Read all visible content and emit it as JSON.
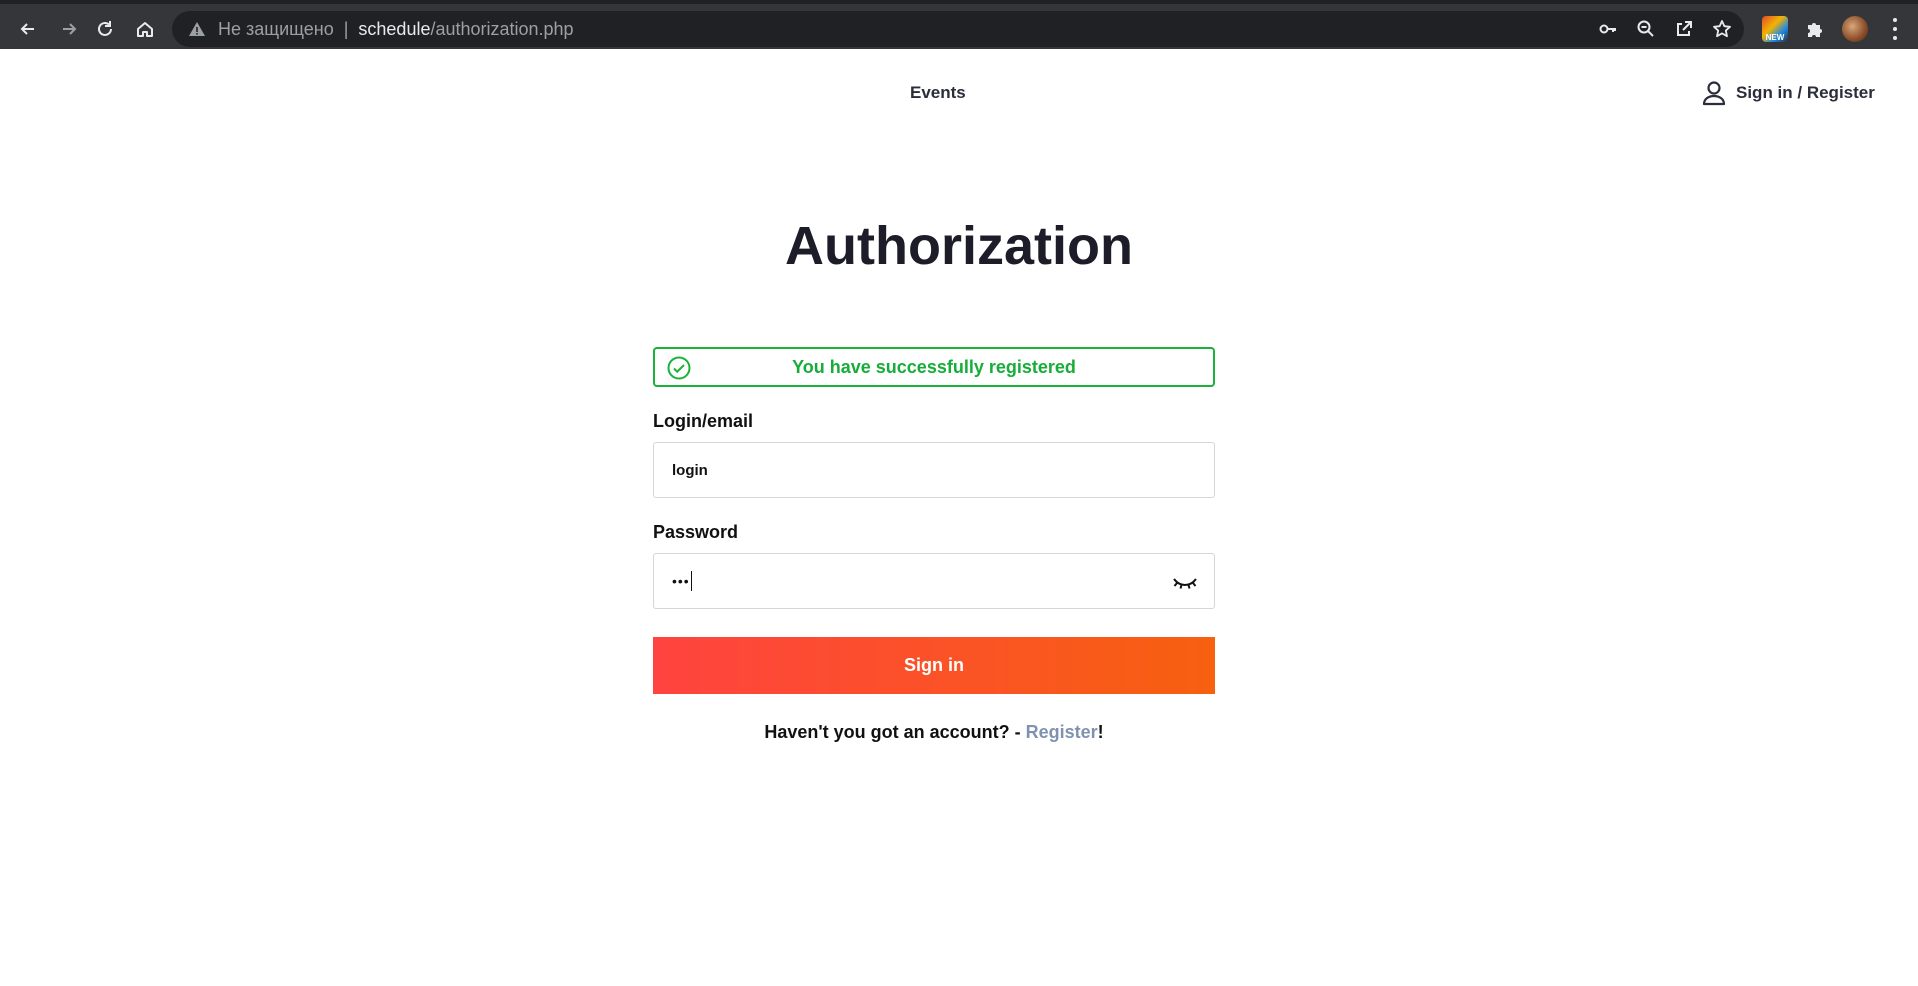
{
  "browser": {
    "security_label": "Не защищено",
    "url_host": "schedule",
    "url_path": "/authorization.php",
    "ext_new_label": "NEW"
  },
  "nav": {
    "events": "Events",
    "auth": "Sign in / Register"
  },
  "page": {
    "title": "Authorization"
  },
  "alert": {
    "message": "You have successfully registered",
    "color": "#19b23a"
  },
  "form": {
    "login_label": "Login/email",
    "login_value": "login",
    "password_label": "Password",
    "password_masked": "•••",
    "submit_label": "Sign in",
    "accent_gradient": [
      "#ff4340",
      "#f7600f"
    ]
  },
  "footer": {
    "prompt": "Haven't you got an account? - ",
    "register_link": "Register",
    "suffix": "!"
  }
}
